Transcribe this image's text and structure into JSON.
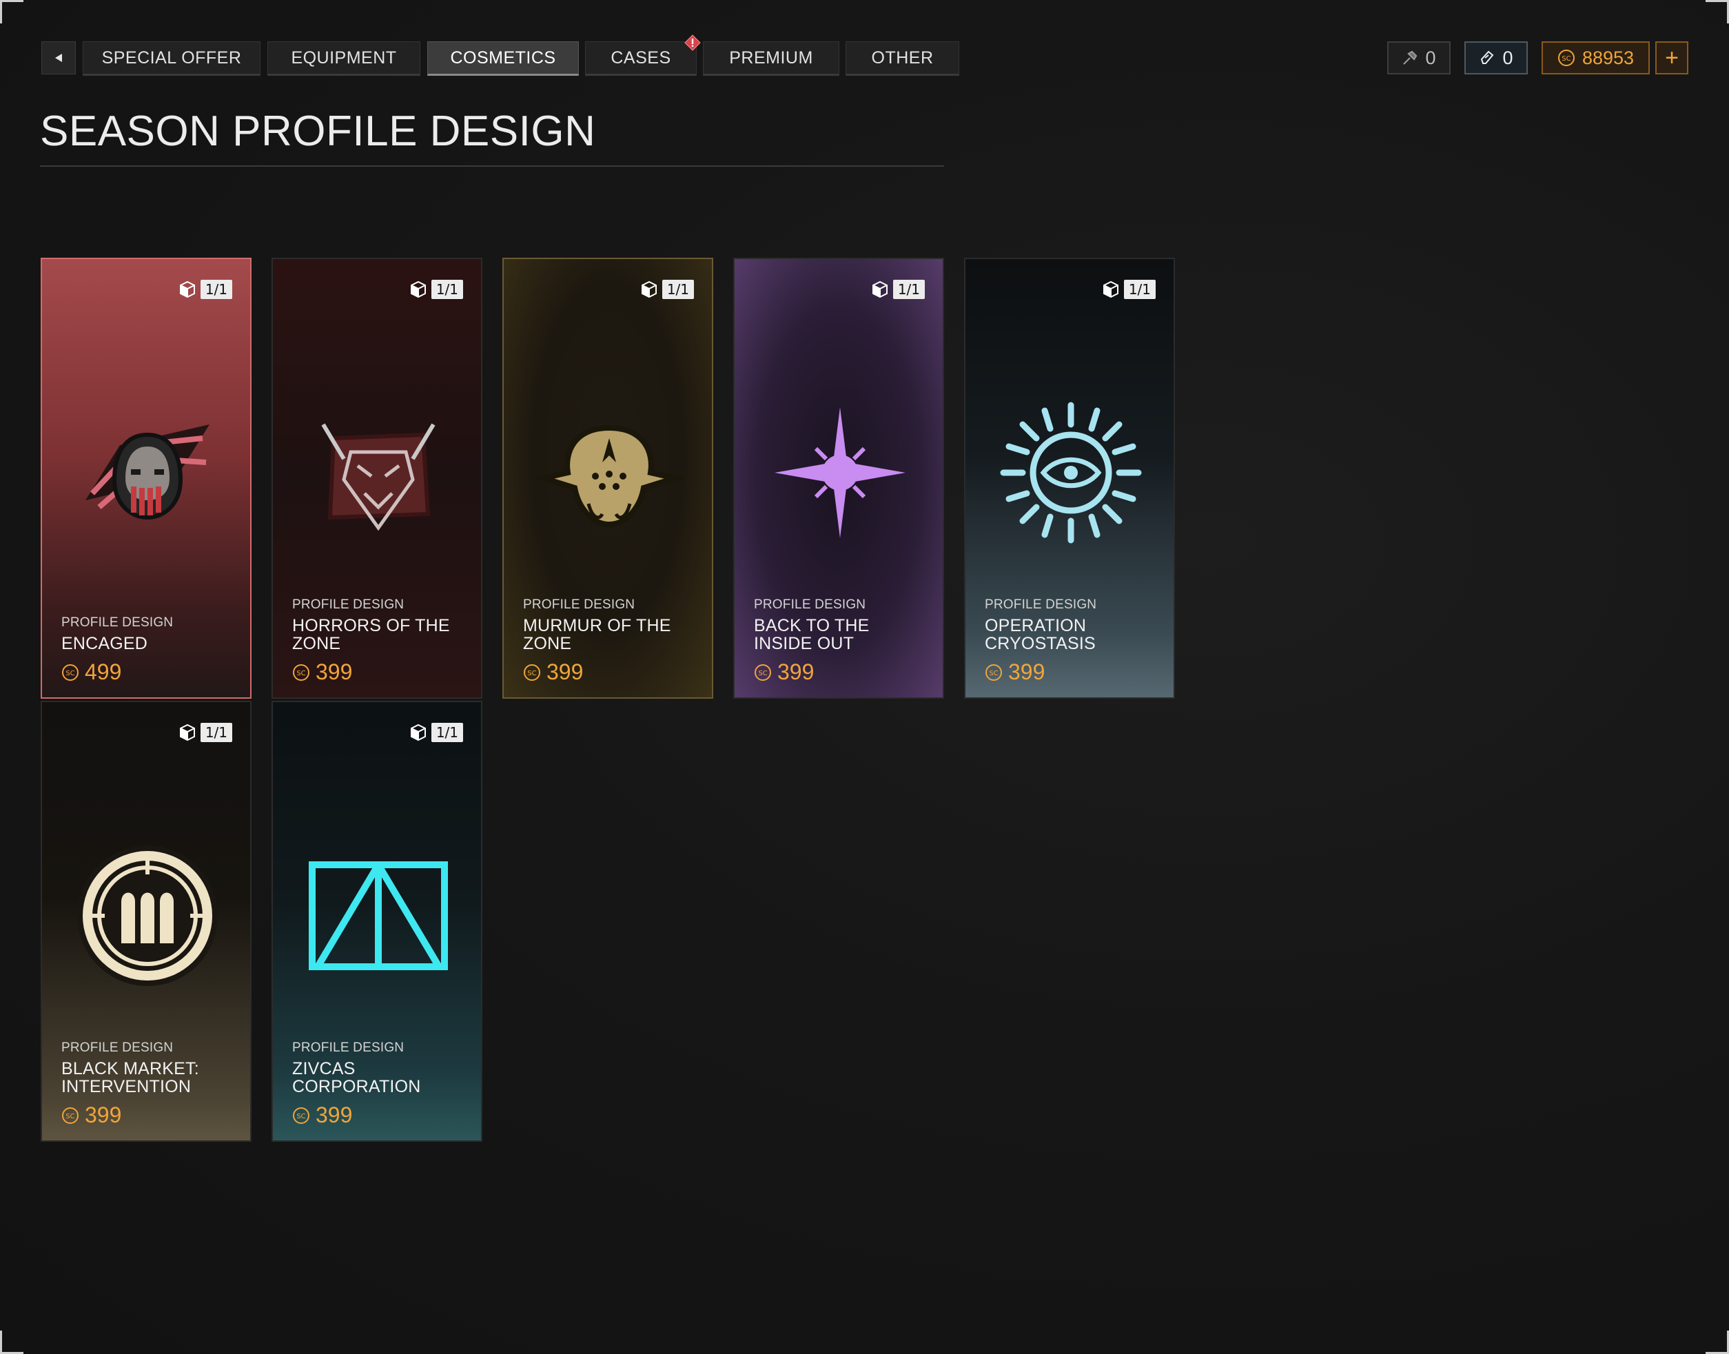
{
  "nav": {
    "tabs": [
      {
        "label": "SPECIAL OFFER"
      },
      {
        "label": "EQUIPMENT"
      },
      {
        "label": "COSMETICS",
        "active": true
      },
      {
        "label": "CASES",
        "alert": true
      },
      {
        "label": "PREMIUM"
      },
      {
        "label": "OTHER"
      }
    ]
  },
  "currencies": {
    "item1": "0",
    "item2": "0",
    "coins": "88953",
    "add_label": "+"
  },
  "page": {
    "title": "SEASON PROFILE DESIGN"
  },
  "cards": [
    {
      "kind": "PROFILE DESIGN",
      "name": "ENCAGED",
      "price": "499",
      "count": "1/1"
    },
    {
      "kind": "PROFILE DESIGN",
      "name": "HORRORS OF THE ZONE",
      "price": "399",
      "count": "1/1"
    },
    {
      "kind": "PROFILE DESIGN",
      "name": "MURMUR OF THE ZONE",
      "price": "399",
      "count": "1/1"
    },
    {
      "kind": "PROFILE DESIGN",
      "name": "BACK TO THE INSIDE OUT",
      "price": "399",
      "count": "1/1"
    },
    {
      "kind": "PROFILE DESIGN",
      "name": "OPERATION CRYOSTASIS",
      "price": "399",
      "count": "1/1"
    },
    {
      "kind": "PROFILE DESIGN",
      "name": "BLACK MARKET: INTERVENTION",
      "price": "399",
      "count": "1/1"
    },
    {
      "kind": "PROFILE DESIGN",
      "name": "ZIVCAS CORPORATION",
      "price": "399",
      "count": "1/1"
    }
  ],
  "colors": {
    "accent_gold": "#f0a53a",
    "alert_red": "#d9434b",
    "cryo_cyan": "#a8e3f0",
    "zivcas_cyan": "#3ee8f0",
    "purple": "#c98cf0"
  }
}
